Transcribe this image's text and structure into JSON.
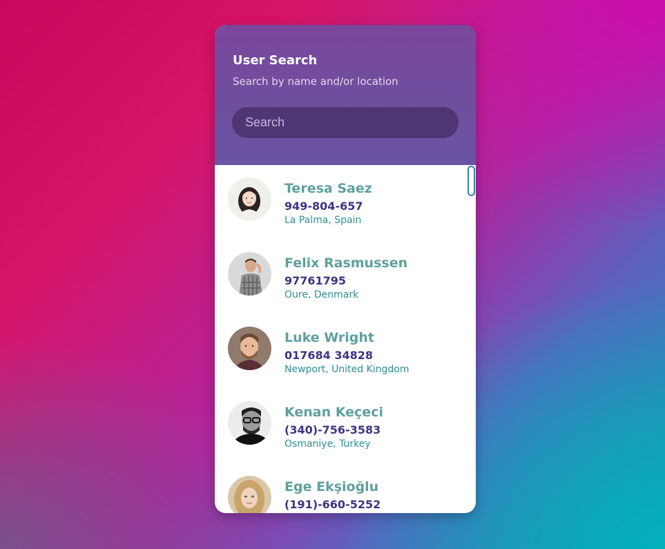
{
  "header": {
    "title": "User Search",
    "subtitle": "Search by name and/or location"
  },
  "search": {
    "placeholder": "Search",
    "value": ""
  },
  "users": [
    {
      "name": "Teresa Saez",
      "phone": "949-804-657",
      "location": "La Palma, Spain",
      "avatar": "avatar-woman-dark-hair"
    },
    {
      "name": "Felix Rasmussen",
      "phone": "97761795",
      "location": "Oure, Denmark",
      "avatar": "avatar-man-plaid-shirt"
    },
    {
      "name": "Luke Wright",
      "phone": "017684 34828",
      "location": "Newport, United Kingdom",
      "avatar": "avatar-man-beard"
    },
    {
      "name": "Kenan Keçeci",
      "phone": "(340)-756-3583",
      "location": "Osmaniye, Turkey",
      "avatar": "avatar-man-glasses-bw"
    },
    {
      "name": "Ege Ekşioğlu",
      "phone": "(191)-660-5252",
      "location": "",
      "avatar": "avatar-woman-blonde"
    }
  ],
  "colors": {
    "header_top": "#7b479c",
    "search_field": "#4e3675",
    "name_text": "#5ea09e",
    "phone_text": "#3b3584",
    "location_text": "#2e8f92",
    "scrollbar": "#2f86a6"
  }
}
